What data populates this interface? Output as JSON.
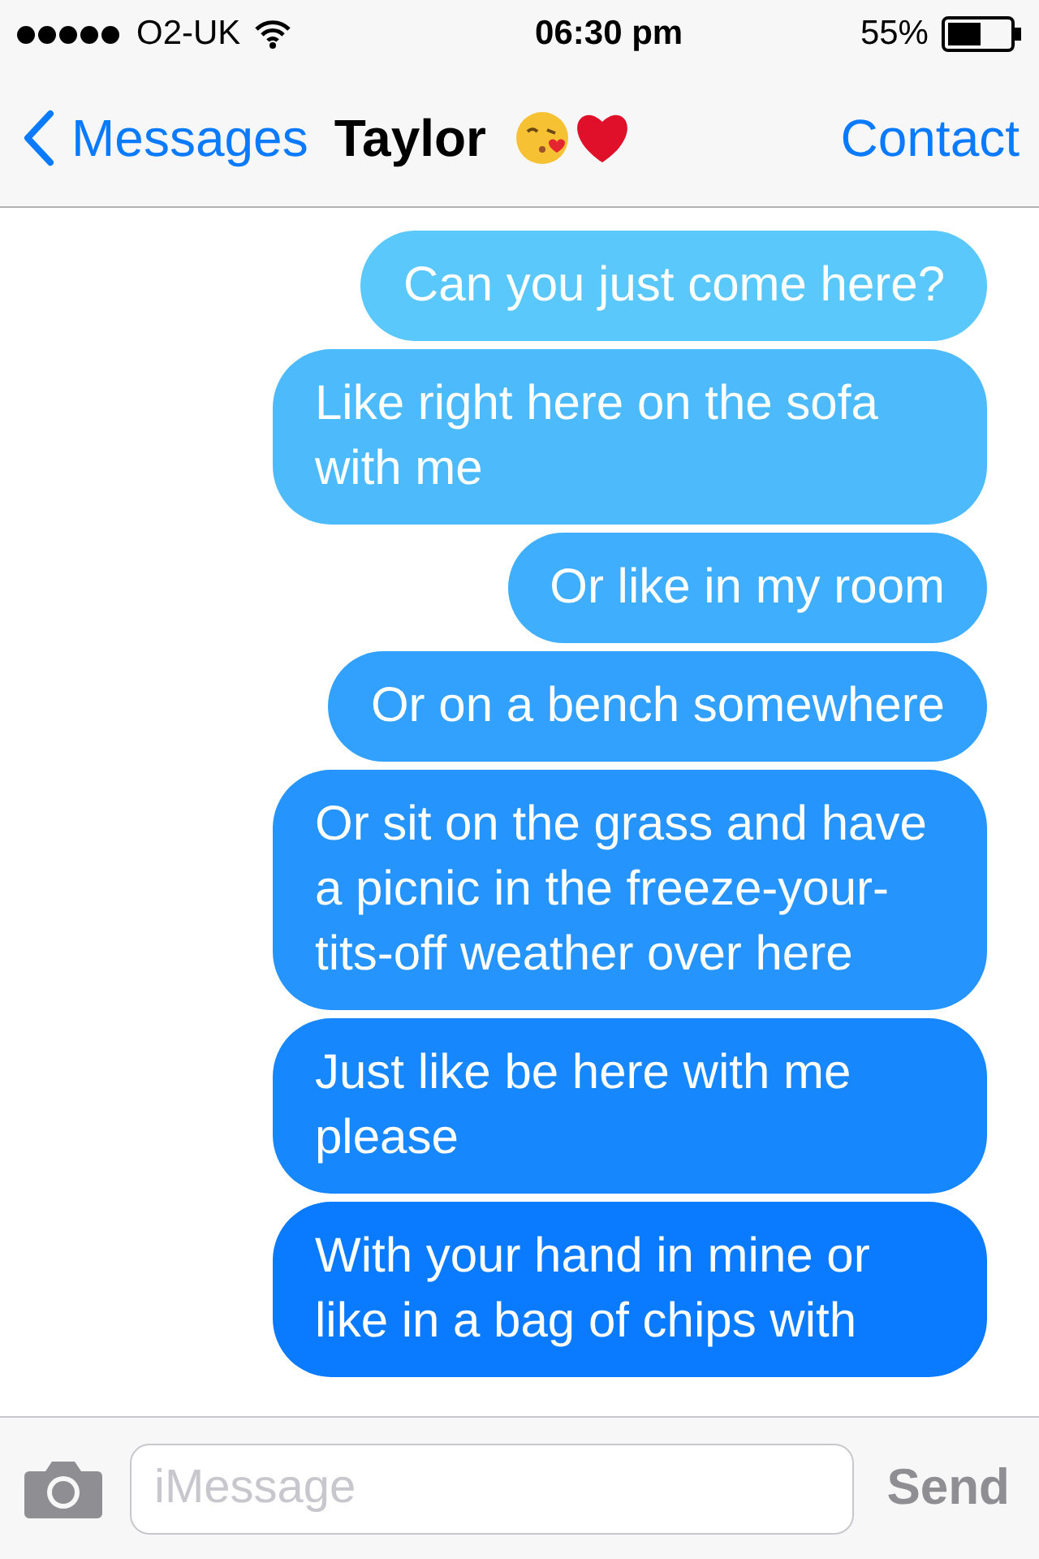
{
  "status_bar": {
    "carrier": "O2-UK",
    "time": "06:30 pm",
    "battery": "55%"
  },
  "nav": {
    "back": "Messages",
    "title": "Taylor",
    "contact": "Contact"
  },
  "messages": [
    {
      "text": "Can you just come here?"
    },
    {
      "text": "Like right here on the sofa with me"
    },
    {
      "text": "Or like in my room"
    },
    {
      "text": "Or on a bench somewhere"
    },
    {
      "text": "Or sit on the grass and have a picnic in the freeze-your-tits-off weather over here"
    },
    {
      "text": "Just like be here with me please"
    },
    {
      "text": "With your hand in mine or like in a bag of chips with"
    }
  ],
  "composer": {
    "placeholder": "iMessage",
    "send": "Send",
    "send_disabled": true
  }
}
